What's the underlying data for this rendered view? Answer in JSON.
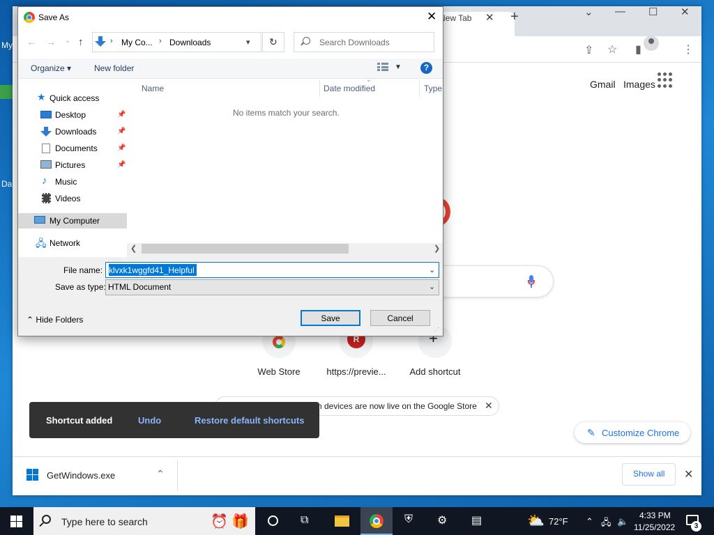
{
  "desktop": {
    "icon_label_1": "My",
    "icon_label_2": "Da"
  },
  "browser": {
    "tab_title": "New Tab",
    "new_tab_glyph": "+",
    "ntp": {
      "gmail_label": "Gmail",
      "images_label": "Images",
      "shortcuts": [
        {
          "label": "Web Store",
          "icon": "chrome-web-store-icon"
        },
        {
          "label": "https://previe...",
          "icon": "r-favicon",
          "letter": "R"
        },
        {
          "label": "Add shortcut",
          "icon": "plus-icon"
        }
      ],
      "promo_text": "n devices are now live on the Google Store",
      "customize_label": "Customize Chrome"
    },
    "toast": {
      "message": "Shortcut added",
      "undo_label": "Undo",
      "restore_label": "Restore default shortcuts"
    },
    "downloads_bar": {
      "file_name": "GetWindows.exe",
      "show_all_label": "Show all"
    }
  },
  "dialog": {
    "title": "Save As",
    "address": {
      "segments": [
        "My Co...",
        "Downloads"
      ]
    },
    "search_placeholder": "Search Downloads",
    "commands": {
      "organize_label": "Organize ▾",
      "new_folder_label": "New folder"
    },
    "nav_items": [
      {
        "label": "Quick access",
        "icon": "star-icon"
      },
      {
        "label": "Desktop",
        "icon": "desktop-icon",
        "pinned": true
      },
      {
        "label": "Downloads",
        "icon": "downloads-icon",
        "pinned": true
      },
      {
        "label": "Documents",
        "icon": "documents-icon",
        "pinned": true
      },
      {
        "label": "Pictures",
        "icon": "pictures-icon",
        "pinned": true
      },
      {
        "label": "Music",
        "icon": "music-icon"
      },
      {
        "label": "Videos",
        "icon": "videos-icon"
      },
      {
        "label": "My Computer",
        "icon": "computer-icon",
        "selected": true
      },
      {
        "label": "Network",
        "icon": "network-icon"
      }
    ],
    "columns": [
      "Name",
      "Date modified",
      "Type"
    ],
    "empty_message": "No items match your search.",
    "file_name_label": "File name:",
    "file_name_value": "klvxk1wggfd41_Helpful",
    "save_type_label": "Save as type:",
    "save_type_value": "HTML Document",
    "hide_folders_label": "Hide Folders",
    "save_label": "Save",
    "cancel_label": "Cancel"
  },
  "taskbar": {
    "search_placeholder": "Type here to search",
    "weather_temp": "72°F",
    "clock_time": "4:33 PM",
    "clock_date": "11/25/2022",
    "notification_count": "3"
  },
  "colors": {
    "accent": "#0078d7",
    "chrome_blue": "#1a73e8",
    "taskbar": "#101723",
    "toast_bg": "#323232"
  }
}
